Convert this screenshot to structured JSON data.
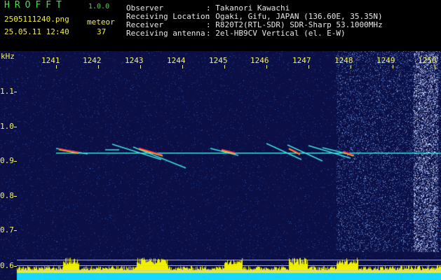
{
  "header": {
    "logo": "HROFFT",
    "version": "1.0.0",
    "filename": "2505111240.png",
    "meteor_label": "meteor",
    "datetime": "25.05.11 12:40",
    "meteor_count": "37",
    "fields": [
      {
        "label": "Observer",
        "value": ": Takanori Kawachi"
      },
      {
        "label": "Receiving Location",
        "value": ": Ogaki, Gifu, JAPAN (136.60E, 35.35N)"
      },
      {
        "label": "Receiver",
        "value": ": R820T2(RTL-SDR) SDR-Sharp 53.1000MHz"
      },
      {
        "label": "Receiving antenna",
        "value": ": 2el-HB9CV Vertical (el. E-W)"
      }
    ]
  },
  "axes": {
    "y_unit": "kHz",
    "time_ticks": [
      "1241",
      "1242",
      "1243",
      "1244",
      "1245",
      "1246",
      "1247",
      "1248",
      "1249",
      "1250"
    ],
    "freq_ticks": [
      "1.1",
      "1.0",
      "0.9",
      "0.8",
      "0.7",
      "0.6"
    ]
  },
  "colors": {
    "background": "#000000",
    "spectrogram_bg": "#0b0f46",
    "header_green": "#4ddc4d",
    "header_yellow": "#f3ef3f",
    "axis_label": "#f5f26a",
    "signal_cyan": "#40e0e0",
    "meteor_red": "#ff3060",
    "bar_yellow": "#f0f000",
    "bar_cyan": "#18d8ff"
  }
}
